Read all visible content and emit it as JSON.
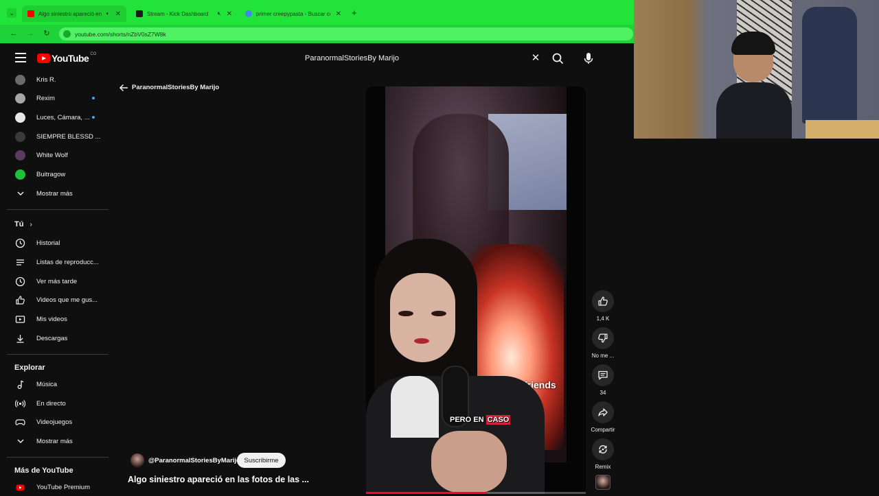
{
  "browser": {
    "tabs": [
      {
        "title": "Algo siniestro apareció en",
        "favicon_color": "#ff0000",
        "active": true
      },
      {
        "title": "Stream - Kick Dashboard",
        "favicon_color": "#1b1b1b",
        "active": false
      },
      {
        "title": "primer creepypasta - Buscar co",
        "favicon_color": "#4285f4",
        "active": false
      }
    ],
    "url": "youtube.com/shorts/nZbV0sZ7W8k"
  },
  "masthead": {
    "logo_text": "YouTube",
    "country_code": "CO",
    "search_value": "ParanormalStoriesBy Marijo"
  },
  "sidebar": {
    "subscriptions": [
      {
        "label": "Kris R.",
        "avatar_color": "#6b6b6b",
        "new": false
      },
      {
        "label": "Rexim",
        "avatar_color": "#a6a6a6",
        "new": true
      },
      {
        "label": "Luces, Cámara, ...",
        "avatar_color": "#e8e8e8",
        "new": true
      },
      {
        "label": "SIEMPRE BLESSD ...",
        "avatar_color": "#3a3a3a",
        "new": false
      },
      {
        "label": "White Wolf",
        "avatar_color": "#5a3a5e",
        "new": false
      },
      {
        "label": "Buitragow",
        "avatar_color": "#1fbf3a",
        "new": false
      }
    ],
    "show_more_1": "Mostrar más",
    "you_heading": "Tú",
    "you_items": [
      {
        "label": "Historial",
        "icon": "history-icon"
      },
      {
        "label": "Listas de reproducc...",
        "icon": "playlist-icon"
      },
      {
        "label": "Ver más tarde",
        "icon": "clock-icon"
      },
      {
        "label": "Videos que me gus...",
        "icon": "thumbs-up-icon"
      },
      {
        "label": "Mis videos",
        "icon": "video-icon"
      },
      {
        "label": "Descargas",
        "icon": "download-icon"
      }
    ],
    "explore_heading": "Explorar",
    "explore_items": [
      {
        "label": "Música",
        "icon": "music-note-icon"
      },
      {
        "label": "En directo",
        "icon": "live-icon"
      },
      {
        "label": "Videojuegos",
        "icon": "gamepad-icon"
      }
    ],
    "show_more_2": "Mostrar más",
    "more_heading": "Más de YouTube",
    "more_items": [
      {
        "label": "YouTube Premium",
        "icon": "youtube-premium-icon"
      }
    ]
  },
  "back_link": "ParanormalStoriesBy Marijo",
  "short": {
    "overlay_text": "friends",
    "caption_plain": "PERO EN ",
    "caption_highlight": "CASO",
    "progress": 0.55,
    "channel_handle": "@ParanormalStoriesByMarijo",
    "subscribe_label": "Suscribirme",
    "title": "Algo siniestro apareció en las fotos de las ..."
  },
  "actions": {
    "like_count": "1,4 K",
    "dislike_label": "No me ...",
    "comment_count": "34",
    "share_label": "Compartir",
    "remix_label": "Remix"
  },
  "colors": {
    "brand_red": "#ff0000",
    "browser_green": "#22e33a",
    "unread_dot": "#3ea6ff"
  }
}
